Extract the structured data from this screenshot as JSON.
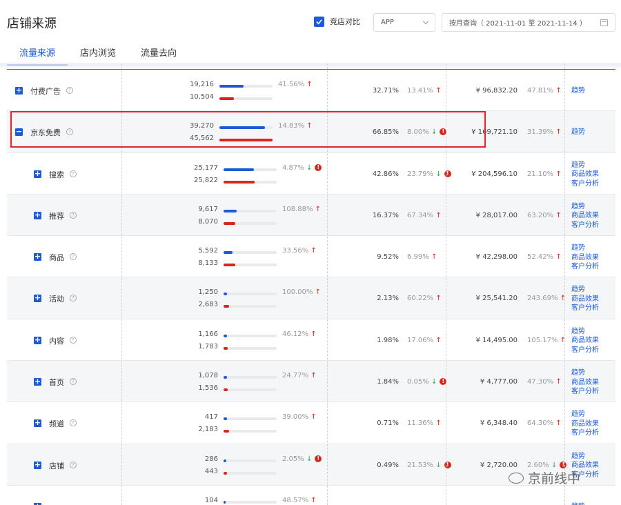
{
  "page": {
    "title": "店铺来源"
  },
  "toolbar": {
    "compare_label": "竞店对比",
    "compare_checked": true,
    "platform_value": "APP",
    "date_range": "按月查询（ 2021-11-01 至 2021-11-14 ）"
  },
  "tabs": [
    {
      "label": "流量来源",
      "active": true
    },
    {
      "label": "店内浏览",
      "active": false
    },
    {
      "label": "流量去向",
      "active": false
    }
  ],
  "rows": [
    {
      "name": "付费广告",
      "toggle": "+",
      "level": 0,
      "v1": "19,216",
      "v2": "10,504",
      "b1": 0.45,
      "b2": 0.27,
      "pct": "41.56%",
      "dir1": "up",
      "alert1": false,
      "c2": "32.71%",
      "c2p": "13.41%",
      "dir2": "up",
      "alert2": false,
      "c3": "¥ 96,832.20",
      "c3p": "47.81%",
      "dir3": "up",
      "alert3": false,
      "links": [
        "趋势"
      ]
    },
    {
      "name": "京东免费",
      "toggle": "−",
      "level": 0,
      "v1": "39,270",
      "v2": "45,562",
      "b1": 0.86,
      "b2": 1.0,
      "pct": "14.83%",
      "dir1": "up",
      "alert1": false,
      "c2": "66.85%",
      "c2p": "8.00%",
      "dir2": "down",
      "alert2": true,
      "c3": "¥ 169,721.10",
      "c3p": "31.39%",
      "dir3": "up",
      "alert3": false,
      "links": [
        "趋势"
      ]
    },
    {
      "name": "搜索",
      "toggle": "+",
      "level": 1,
      "v1": "25,177",
      "v2": "25,822",
      "b1": 0.57,
      "b2": 0.59,
      "pct": "4.87%",
      "dir1": "down",
      "alert1": true,
      "c2": "42.86%",
      "c2p": "23.79%",
      "dir2": "down",
      "alert2": true,
      "c3": "¥ 204,596.10",
      "c3p": "21.10%",
      "dir3": "up",
      "alert3": false,
      "links": [
        "趋势",
        "商品效果",
        "客户分析"
      ]
    },
    {
      "name": "推荐",
      "toggle": "+",
      "level": 1,
      "v1": "9,617",
      "v2": "8,070",
      "b1": 0.25,
      "b2": 0.22,
      "pct": "108.88%",
      "dir1": "up",
      "alert1": false,
      "c2": "16.37%",
      "c2p": "67.34%",
      "dir2": "up",
      "alert2": false,
      "c3": "¥ 28,017.00",
      "c3p": "63.20%",
      "dir3": "up",
      "alert3": false,
      "links": [
        "趋势",
        "商品效果",
        "客户分析"
      ]
    },
    {
      "name": "商品",
      "toggle": "+",
      "level": 1,
      "v1": "5,592",
      "v2": "8,133",
      "b1": 0.17,
      "b2": 0.22,
      "pct": "33.56%",
      "dir1": "up",
      "alert1": false,
      "c2": "9.52%",
      "c2p": "6.99%",
      "dir2": "up",
      "alert2": false,
      "c3": "¥ 42,298.00",
      "c3p": "52.42%",
      "dir3": "up",
      "alert3": false,
      "links": [
        "趋势",
        "商品效果",
        "客户分析"
      ]
    },
    {
      "name": "活动",
      "toggle": "+",
      "level": 1,
      "v1": "1,250",
      "v2": "2,683",
      "b1": 0.07,
      "b2": 0.1,
      "pct": "100.00%",
      "dir1": "up",
      "alert1": false,
      "c2": "2.13%",
      "c2p": "60.22%",
      "dir2": "up",
      "alert2": false,
      "c3": "¥ 25,541.20",
      "c3p": "243.69%",
      "dir3": "up",
      "alert3": false,
      "links": [
        "趋势",
        "商品效果",
        "客户分析"
      ]
    },
    {
      "name": "内容",
      "toggle": "+",
      "level": 1,
      "v1": "1,166",
      "v2": "1,783",
      "b1": 0.07,
      "b2": 0.08,
      "pct": "46.12%",
      "dir1": "up",
      "alert1": false,
      "c2": "1.98%",
      "c2p": "17.06%",
      "dir2": "up",
      "alert2": false,
      "c3": "¥ 14,495.00",
      "c3p": "105.17%",
      "dir3": "up",
      "alert3": false,
      "links": [
        "趋势",
        "商品效果",
        "客户分析"
      ]
    },
    {
      "name": "首页",
      "toggle": "+",
      "level": 1,
      "v1": "1,078",
      "v2": "1,536",
      "b1": 0.07,
      "b2": 0.08,
      "pct": "24.77%",
      "dir1": "up",
      "alert1": false,
      "c2": "1.84%",
      "c2p": "0.05%",
      "dir2": "down",
      "alert2": true,
      "c3": "¥ 4,777.00",
      "c3p": "47.30%",
      "dir3": "up",
      "alert3": false,
      "links": [
        "趋势",
        "商品效果",
        "客户分析"
      ]
    },
    {
      "name": "频道",
      "toggle": "+",
      "level": 1,
      "v1": "417",
      "v2": "2,183",
      "b1": 0.06,
      "b2": 0.1,
      "pct": "39.00%",
      "dir1": "up",
      "alert1": false,
      "c2": "0.71%",
      "c2p": "11.36%",
      "dir2": "up",
      "alert2": false,
      "c3": "¥ 6,348.40",
      "c3p": "64.30%",
      "dir3": "up",
      "alert3": false,
      "links": [
        "趋势",
        "商品效果",
        "客户分析"
      ]
    },
    {
      "name": "店铺",
      "toggle": "+",
      "level": 1,
      "v1": "286",
      "v2": "443",
      "b1": 0.05,
      "b2": 0.06,
      "pct": "2.05%",
      "dir1": "down",
      "alert1": true,
      "c2": "0.49%",
      "c2p": "21.53%",
      "dir2": "down",
      "alert2": true,
      "c3": "¥ 2,720.00",
      "c3p": "2.60%",
      "dir3": "down",
      "alert3": true,
      "links": [
        "趋势",
        "商品效果",
        "客户分析"
      ]
    },
    {
      "name": "",
      "toggle": "+",
      "level": 1,
      "v1": "104",
      "v2": "",
      "b1": 0.04,
      "b2": 0,
      "pct": "48.57%",
      "dir1": "up",
      "alert1": false,
      "c2": "",
      "c2p": "",
      "dir2": "",
      "alert2": false,
      "c3": "",
      "c3p": "",
      "dir3": "",
      "alert3": false,
      "links": [
        "趋势"
      ]
    }
  ],
  "watermark": "京前线中",
  "colors": {
    "accent": "#1d5bd6",
    "competitor": "#d9251c",
    "highlight_border": "#e3242b"
  }
}
